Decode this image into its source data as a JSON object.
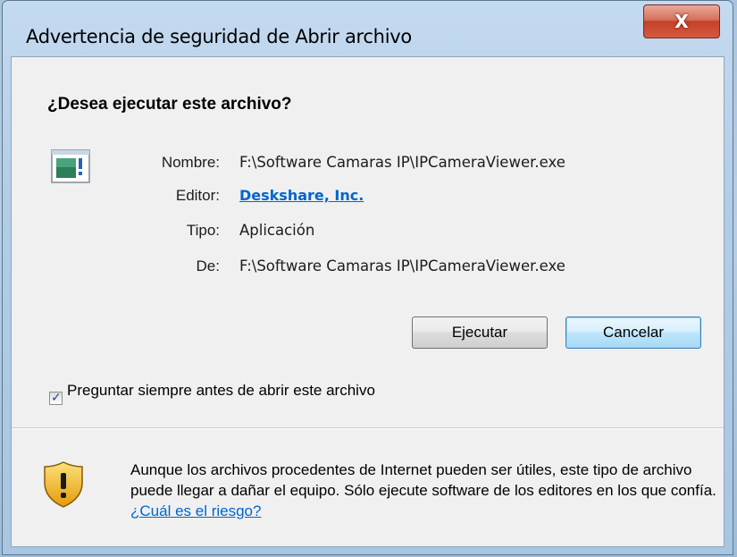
{
  "window": {
    "title": "Advertencia de seguridad de Abrir archivo",
    "close_label": "X"
  },
  "dialog": {
    "question": "¿Desea ejecutar este archivo?",
    "fields": {
      "name_label": "Nombre:",
      "name_value": "F:\\Software Camaras IP\\IPCameraViewer.exe",
      "publisher_label": "Editor:",
      "publisher_value": "Deskshare, Inc.",
      "type_label": "Tipo:",
      "type_value": "Aplicación",
      "from_label": "De:",
      "from_value": "F:\\Software Camaras IP\\IPCameraViewer.exe"
    },
    "buttons": {
      "run": "Ejecutar",
      "cancel": "Cancelar"
    },
    "checkbox": {
      "label": "Preguntar siempre antes de abrir este archivo",
      "checked": true
    },
    "warning": {
      "text": "Aunque los archivos procedentes de Internet pueden ser útiles, este tipo de archivo puede llegar a dañar el equipo. Sólo ejecute software de los editores en los que confía. ",
      "link": "¿Cuál es el riesgo?"
    }
  },
  "icons": {
    "file": "application-file-icon",
    "warning": "security-shield-icon",
    "close": "close-icon"
  },
  "colors": {
    "link": "#0066cc",
    "close_button": "#c3402a",
    "default_button_border": "#3c7fb1",
    "shield": "#f2b51c"
  }
}
